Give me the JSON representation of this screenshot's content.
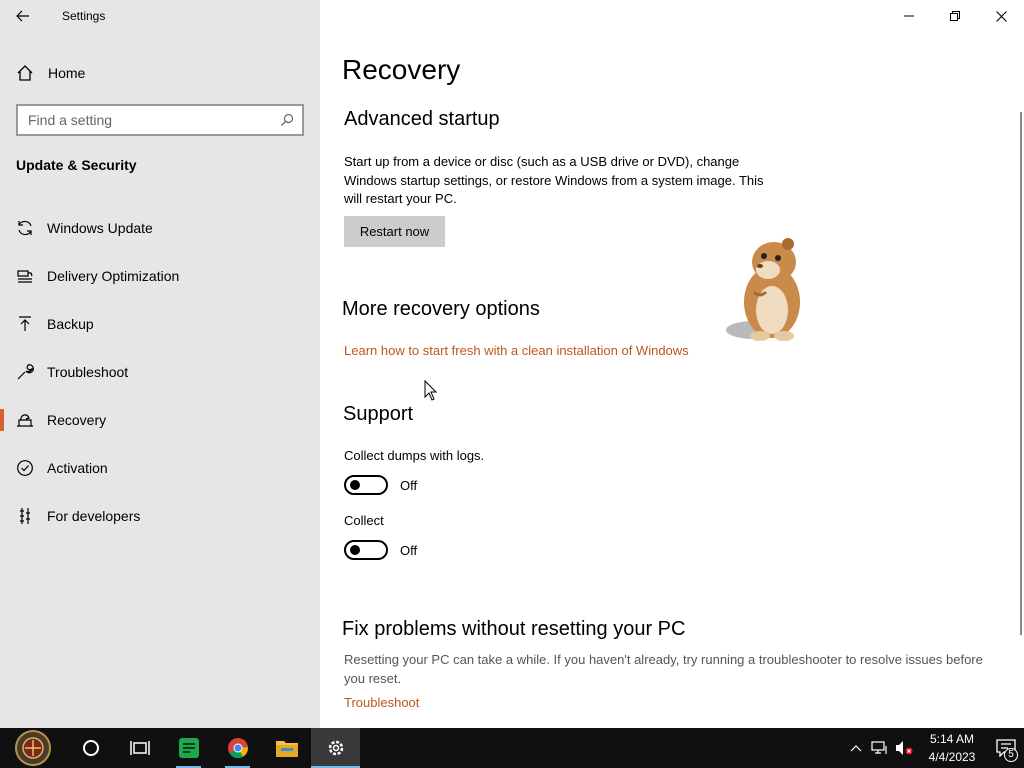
{
  "window": {
    "title": "Settings",
    "icons": {
      "back": "back-arrow-icon",
      "minimize": "minimize-icon",
      "maximize": "restore-icon",
      "close": "close-icon"
    }
  },
  "sidebar": {
    "home_label": "Home",
    "search": {
      "placeholder": "Find a setting",
      "value": ""
    },
    "section_title": "Update & Security",
    "items": [
      {
        "label": "Windows Update",
        "icon": "refresh-icon",
        "active": false
      },
      {
        "label": "Delivery Optimization",
        "icon": "delivery-optimization-icon",
        "active": false
      },
      {
        "label": "Backup",
        "icon": "backup-upload-icon",
        "active": false
      },
      {
        "label": "Troubleshoot",
        "icon": "wrench-icon",
        "active": false
      },
      {
        "label": "Recovery",
        "icon": "recovery-icon",
        "active": true
      },
      {
        "label": "Activation",
        "icon": "checkmark-circle-icon",
        "active": false
      },
      {
        "label": "For developers",
        "icon": "developer-icon",
        "active": false
      }
    ]
  },
  "main": {
    "page_title": "Recovery",
    "advanced_startup": {
      "heading": "Advanced startup",
      "description": "Start up from a device or disc (such as a USB drive or DVD), change Windows startup settings, or restore Windows from a system image. This will restart your PC.",
      "button_label": "Restart now"
    },
    "more_options": {
      "heading": "More recovery options",
      "link": "Learn how to start fresh with a clean installation of Windows"
    },
    "support": {
      "heading": "Support",
      "toggles": [
        {
          "label": "Collect dumps with logs.",
          "state": "Off"
        },
        {
          "label": "Collect",
          "state": "Off"
        }
      ]
    },
    "fix_problems": {
      "heading": "Fix problems without resetting your PC",
      "description": "Resetting your PC can take a while. If you haven't already, try running a troubleshooter to resolve issues before you reset.",
      "link": "Troubleshoot"
    }
  },
  "taskbar": {
    "apps": [
      {
        "name": "start-button",
        "icon": "start-logo-icon"
      },
      {
        "name": "cortana-search",
        "icon": "cortana-circle-icon"
      },
      {
        "name": "task-view",
        "icon": "task-view-icon"
      },
      {
        "name": "notes-app",
        "icon": "green-notes-icon"
      },
      {
        "name": "chrome",
        "icon": "chrome-icon"
      },
      {
        "name": "file-explorer",
        "icon": "folder-icon"
      },
      {
        "name": "settings",
        "icon": "gear-icon"
      }
    ],
    "clock": {
      "time": "5:14 AM",
      "date": "4/4/2023"
    },
    "notification_count": "5"
  },
  "colors": {
    "accent": "#d4622a",
    "link": "#c0561d",
    "sidebar_bg": "#e6e6e6",
    "taskbar_bg": "#101010"
  }
}
